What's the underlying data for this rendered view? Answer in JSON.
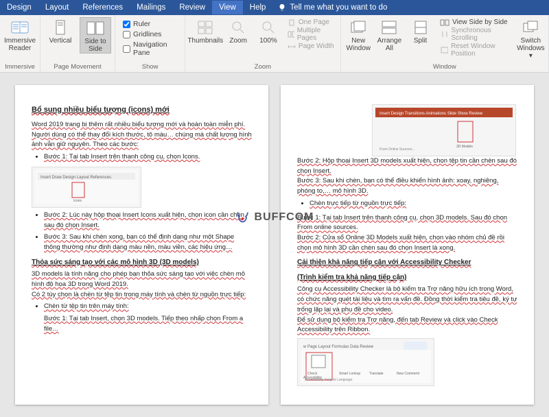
{
  "menu": {
    "items": [
      "Design",
      "Layout",
      "References",
      "Mailings",
      "Review",
      "View",
      "Help"
    ],
    "tell": "Tell me what you want to do"
  },
  "ribbon": {
    "immersive": {
      "label": "Immersive",
      "btn": "Immersive Reader"
    },
    "movement": {
      "label": "Page Movement",
      "vertical": "Vertical",
      "side": "Side to Side"
    },
    "show": {
      "label": "Show",
      "ruler": "Ruler",
      "grid": "Gridlines",
      "nav": "Navigation Pane"
    },
    "zoom": {
      "label": "Zoom",
      "thumb": "Thumbnails",
      "zoom": "Zoom",
      "pct": "100%",
      "one": "One Page",
      "multi": "Multiple Pages",
      "width": "Page Width"
    },
    "window": {
      "label": "Window",
      "new": "New Window",
      "arrange": "Arrange All",
      "split": "Split",
      "sbs": "View Side by Side",
      "sync": "Synchronous Scrolling",
      "reset": "Reset Window Position",
      "switch": "Switch Windows"
    }
  },
  "watermark": "BUFFCOM",
  "p1": {
    "h1": "Bổ sung nhiều biểu tượng (icons) mới",
    "t1": "Word 2019 trang bị thêm rất nhiều biểu tượng mới và hoàn toàn miễn phí. Người dùng có thể thay đổi kích thước, tô màu… chúng mà chất lượng hình ảnh vẫn giữ nguyên. Theo các bước:",
    "b1": "Bước 1: Tại tab Insert trên thanh công cụ, chọn Icons.",
    "b2": "Bước 2: Lúc này hộp thoại Insert Icons xuất hiện, chọn icon cần chèn sau đó chọn Insert.",
    "b3": "Bước 3: Sau khi chèn xong, bạn có thể định dạng như một Shape thông thường như định dạng màu nền, màu viền, các hiệu ứng…",
    "h2": "Thỏa sức sáng tạo với các mô hình 3D (3D models)",
    "t2": "3D models là tính năng cho phép bạn thỏa sức sáng tạo với việc chèn mô hình độ họa 3D trong Word 2019.",
    "t3": "Có 2 tùy chọn là chèn từ tệp tin trong máy tính và chèn từ nguồn trực tiếp:",
    "b4": "Chèn từ tệp tin trên máy tính:",
    "b5": "Bước 1: Tại tab Insert, chọn 3D models. Tiếp theo nhấp chọn From a file…"
  },
  "p2": {
    "b1": "Bước 2: Hộp thoại Insert 3D models xuất hiện, chọn tệp tin cần chèn sau đó chọn Insert.",
    "b2": "Bước 3: Sau khi chèn, bạn có thể điều khiển hình ảnh: xoay, nghiêng, phóng to,… mô hình 3D.",
    "b3": "Chèn trực tiếp từ nguồn trực tiếp:",
    "b4": "Bước 1: Tại tab Insert trên thanh công cụ, chọn 3D models. Sau đó chọn From online sources.",
    "b5": "Bước 2: Cửa sổ Online 3D Models xuất hiện, chọn vào nhóm chủ đề rồi chọn mô hình 3D cần chèn sau đó chọn Insert là xong.",
    "h1": "Cải thiện khả năng tiếp cận với Accessibility Checker",
    "h1b": "(Trình kiểm tra khả năng tiếp cận)",
    "t1": "Công cụ Accessibility Checker là bộ kiểm tra Trợ năng hữu ích trong Word, có chức năng quét tài liệu và tìm ra vấn đề. Đồng thời kiểm tra tiêu đề, ký tự trống lặp lại và phụ đề cho video.",
    "t2": "Để sử dụng bộ kiểm tra Trợ năng, đến tab Review và click vào Check Accessibility trên Ribbon."
  }
}
